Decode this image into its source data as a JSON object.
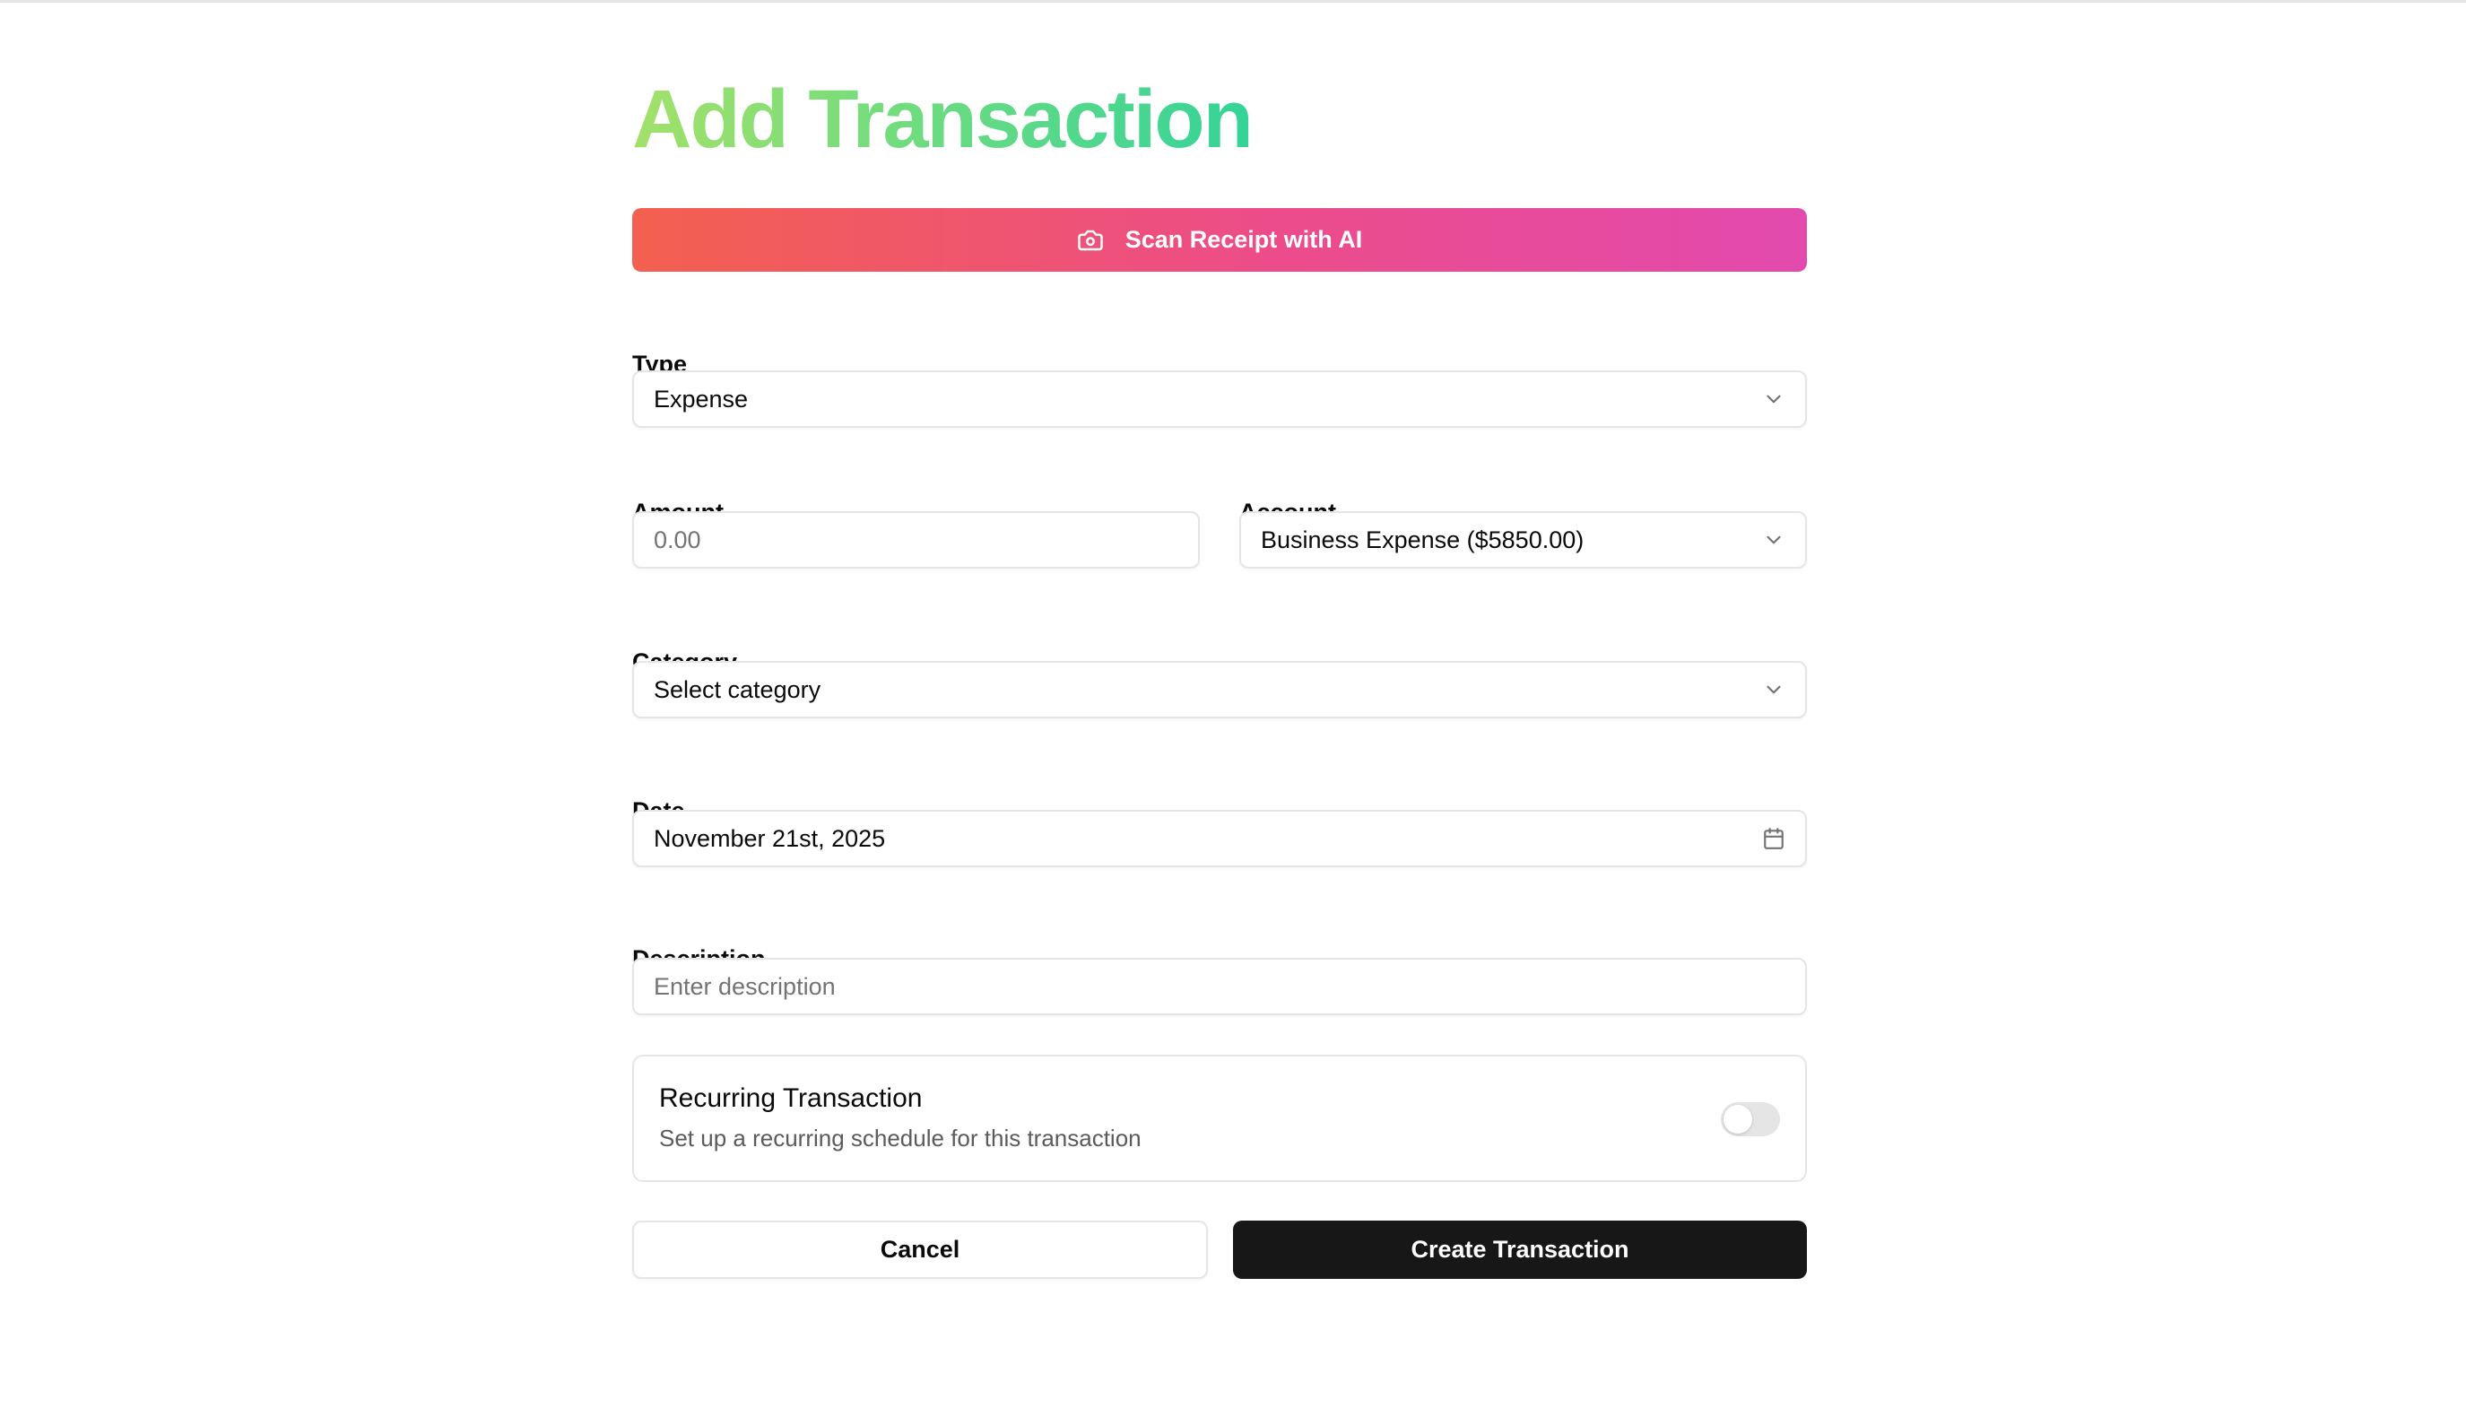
{
  "page": {
    "title": "Add Transaction"
  },
  "scan": {
    "label": "Scan Receipt with AI",
    "icon": "camera-icon"
  },
  "form": {
    "type": {
      "label": "Type",
      "value": "Expense"
    },
    "amount": {
      "label": "Amount",
      "value": "",
      "placeholder": "0.00"
    },
    "account": {
      "label": "Account",
      "value": "Business Expense ($5850.00)"
    },
    "category": {
      "label": "Category",
      "value": "Select category"
    },
    "date": {
      "label": "Date",
      "value": "November 21st, 2025"
    },
    "description": {
      "label": "Description",
      "value": "",
      "placeholder": "Enter description"
    }
  },
  "recurring": {
    "title": "Recurring Transaction",
    "subtitle": "Set up a recurring schedule for this transaction",
    "enabled": false
  },
  "actions": {
    "cancel": "Cancel",
    "create": "Create Transaction"
  },
  "colors": {
    "title_gradient": [
      "#a3e06a",
      "#34d399"
    ],
    "scan_gradient": [
      "#f3604f",
      "#e24aae"
    ],
    "primary_button": "#171717",
    "border": "#e5e5e5"
  }
}
